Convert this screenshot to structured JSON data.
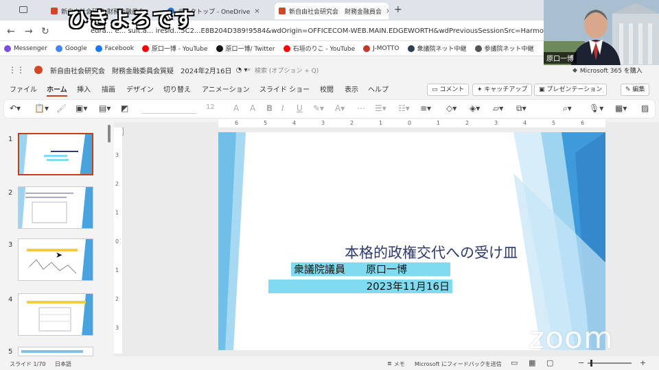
{
  "caption": "ひきよろです",
  "browser": {
    "tabs": [
      {
        "label": "新自由社会研究会"
      },
      {
        "label": "財務金融員会"
      },
      {
        "label": "デスクトップ - OneDrive"
      },
      {
        "label": "新自由社会研究会　財務金融員会"
      }
    ],
    "url": "edra... e... sult.a... iresid...5C2...E8B204D389!9584&wdOrigin=OFFICECOM-WEB.MAIN.EDGEWORTH&wdPreviousSessionSrc=Harmon...",
    "bookmarks": [
      {
        "label": "Messenger",
        "color": "#7b4de0"
      },
      {
        "label": "Google",
        "color": "#4285f4"
      },
      {
        "label": "Facebook",
        "color": "#1877f2"
      },
      {
        "label": "原口一博 - YouTube",
        "color": "#ff0000"
      },
      {
        "label": "原口一博/ Twitter",
        "color": "#111111"
      },
      {
        "label": "石垣のりこ - YouTube",
        "color": "#ff0000"
      },
      {
        "label": "J-MOTTO",
        "color": "#c0392b"
      },
      {
        "label": "衆議院ネット中継",
        "color": "#2c3e50"
      },
      {
        "label": "参議院ネット中継",
        "color": "#555555"
      }
    ]
  },
  "app": {
    "doc_title": "新自由社会研究会　財務金融委員会質疑　2024年2月16日",
    "search_placeholder": "検索 (オプション + Q)",
    "buy_label": "Microsoft 365 を購入"
  },
  "ribbon": {
    "tabs": [
      "ファイル",
      "ホーム",
      "挿入",
      "描画",
      "デザイン",
      "切り替え",
      "アニメーション",
      "スライド ショー",
      "校閲",
      "表示",
      "ヘルプ"
    ],
    "selected": "ホーム",
    "comment_label": "コメント",
    "catchup_label": "キャッチアップ",
    "present_label": "プレゼンテーション",
    "edit_label": "編集",
    "font_size": "12"
  },
  "slides_panel": {
    "numbers": [
      "1",
      "2",
      "3",
      "4",
      "5"
    ]
  },
  "slide": {
    "title": "本格的政権交代への受け皿",
    "line1": "衆議院議員　　原口一博",
    "line2": "2023年11月16日",
    "accent": "#7fdcf0",
    "title_color": "#2e3a6e"
  },
  "ruler": {
    "h": [
      "6",
      "5",
      "4",
      "3",
      "2",
      "1",
      "0",
      "1",
      "2",
      "3",
      "4",
      "5",
      "6"
    ],
    "v": [
      "3",
      "2",
      "1",
      "0",
      "1",
      "2",
      "3"
    ]
  },
  "video": {
    "name": "原口一博"
  },
  "status": {
    "slide": "スライド 1/70",
    "lang": "日本語",
    "notes": "メモ",
    "feedback": "Microsoft にフィードバックを送信"
  },
  "zoom_logo": "zoom"
}
